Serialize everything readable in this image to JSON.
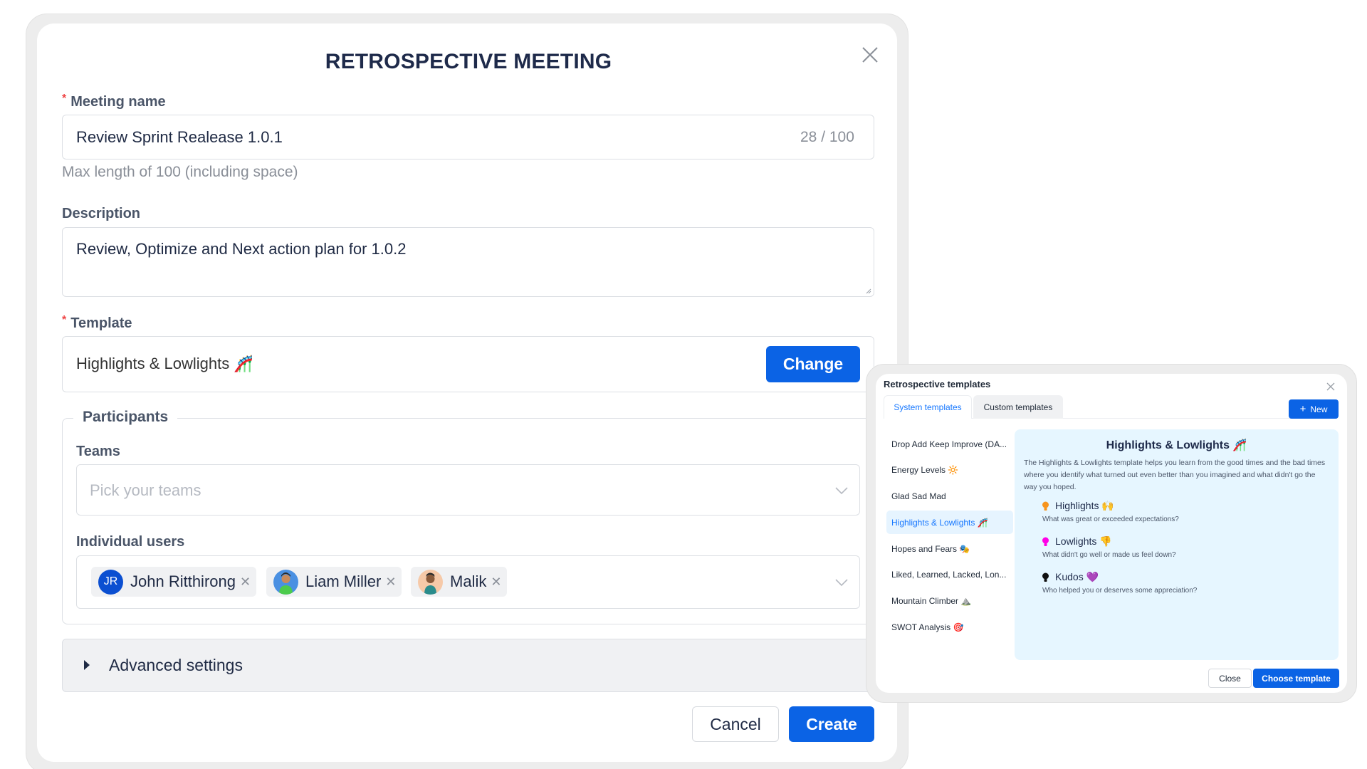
{
  "colors": {
    "primary": "#0b63e5",
    "title": "#1e2a4a",
    "required": "#ef4444",
    "selected_text": "#1677ff",
    "selected_bg": "#e6f4ff",
    "detail_bg": "#e6f6ff"
  },
  "meeting_modal": {
    "title": "RETROSPECTIVE MEETING",
    "close_icon": "close-icon",
    "meeting_name": {
      "required_mark": "*",
      "label": "Meeting name",
      "value": "Review Sprint Realease 1.0.1",
      "counter": "28 / 100",
      "helper": "Max length of 100 (including space)"
    },
    "description": {
      "label": "Description",
      "value": "Review, Optimize and Next action plan for 1.0.2"
    },
    "template": {
      "required_mark": "*",
      "label": "Template",
      "value": "Highlights & Lowlights 🎢",
      "change_label": "Change"
    },
    "participants": {
      "legend": "Participants",
      "teams": {
        "label": "Teams",
        "placeholder": "Pick your teams"
      },
      "individual_users": {
        "label": "Individual users",
        "users": [
          {
            "name": "John Ritthirong",
            "initials": "JR",
            "avatar_color": "#0b4fd1"
          },
          {
            "name": "Liam Miller",
            "initials": "",
            "avatar_color": "#4a90e2"
          },
          {
            "name": "Malik",
            "initials": "",
            "avatar_color": "#f6c9a8"
          }
        ],
        "remove_glyph": "✕"
      }
    },
    "advanced_settings": {
      "label": "Advanced settings"
    },
    "footer": {
      "cancel_label": "Cancel",
      "create_label": "Create"
    }
  },
  "templates_modal": {
    "title": "Retrospective templates",
    "tabs": [
      {
        "label": "System templates",
        "active": true
      },
      {
        "label": "Custom templates",
        "active": false
      }
    ],
    "new_button": {
      "icon": "+",
      "label": "New"
    },
    "list": [
      {
        "label": "Drop Add Keep Improve (DA..."
      },
      {
        "label": "Energy Levels 🔆"
      },
      {
        "label": "Glad Sad Mad"
      },
      {
        "label": "Highlights & Lowlights 🎢",
        "selected": true
      },
      {
        "label": "Hopes and Fears 🎭"
      },
      {
        "label": "Liked, Learned, Lacked, Lon..."
      },
      {
        "label": "Mountain Climber ⛰️"
      },
      {
        "label": "SWOT Analysis 🎯"
      }
    ],
    "detail": {
      "title": "Highlights & Lowlights 🎢",
      "description": "The Highlights & Lowlights template helps you learn from the good times and the bad times where you identify what turned out even better than you imagined and what didn't go the way you hoped.",
      "sections": [
        {
          "title": "Highlights 🙌",
          "desc": "What was great or exceeded expectations?",
          "bulb_color": "#f7941d"
        },
        {
          "title": "Lowlights 👎",
          "desc": "What didn't go well or made us feel down?",
          "bulb_color": "#ff00e6"
        },
        {
          "title": "Kudos 💜",
          "desc": "Who helped you or deserves some appreciation?",
          "bulb_color": "#111111"
        }
      ]
    },
    "footer": {
      "close_label": "Close",
      "choose_label": "Choose template"
    }
  }
}
